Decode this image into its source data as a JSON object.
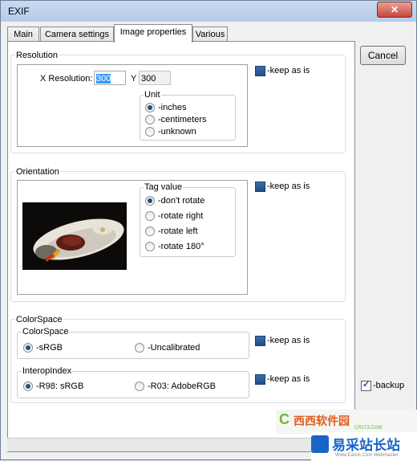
{
  "window": {
    "title": "EXIF",
    "close_glyph": "✕"
  },
  "tabs": [
    {
      "label": "Main"
    },
    {
      "label": "Camera settings"
    },
    {
      "label": "Image properties"
    },
    {
      "label": "Various"
    }
  ],
  "buttons": {
    "cancel": "Cancel"
  },
  "backup": {
    "label": "-backup",
    "checked": true
  },
  "resolution": {
    "title": "Resolution",
    "x_label": "X Resolution:",
    "x_value": "300",
    "y_label": "Y",
    "y_value": "300",
    "unit_title": "Unit",
    "units": [
      "-inches",
      "-centimeters",
      "-unknown"
    ],
    "unit_selected": 0,
    "keep_label": "-keep as is"
  },
  "orientation": {
    "title": "Orientation",
    "tag_title": "Tag value",
    "options": [
      "-don't rotate",
      "-rotate right",
      "-rotate left",
      "-rotate 180°"
    ],
    "selected": 0,
    "keep_label": "-keep as is"
  },
  "colorspace": {
    "title": "ColorSpace",
    "sub_title": "ColorSpace",
    "options": [
      "-sRGB",
      "-Uncalibrated"
    ],
    "selected": 0,
    "keep_label": "-keep as is",
    "interop_title": "InteropIndex",
    "interop_options": [
      "-R98: sRGB",
      "-R03: AdobeRGB"
    ],
    "interop_selected": 0,
    "interop_keep_label": "-keep as is"
  },
  "watermarks": {
    "brand1": "西西软件园",
    "brand1_sub": "CR173.COM",
    "brand2": "易采站长站",
    "brand2_sub": "Www.Easck.Com Webmaster"
  },
  "colors": {
    "accent": "#1f4f8a",
    "selection": "#3399ff",
    "close": "#c8463a"
  }
}
